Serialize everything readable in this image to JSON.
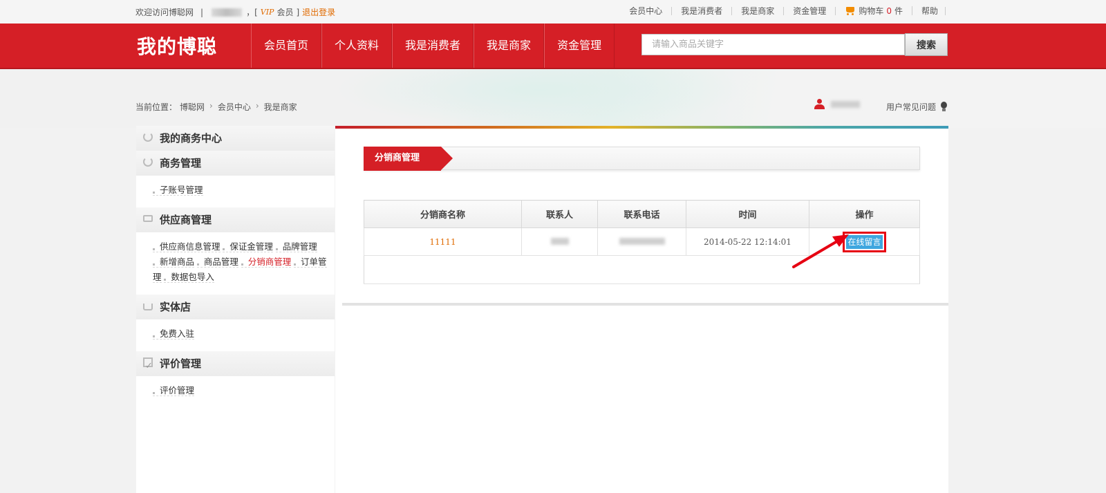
{
  "topbar": {
    "welcome": "欢迎访问博聪网",
    "bracket_open": "，[",
    "vip": "VIP",
    "member": "会员",
    "bracket_close": "]",
    "logout": "退出登录",
    "links": [
      "会员中心",
      "我是消费者",
      "我是商家",
      "资金管理"
    ],
    "cart_label": "购物车",
    "cart_count": "0",
    "cart_unit": "件",
    "help": "帮助"
  },
  "header": {
    "logo": "我的博聪",
    "nav": [
      "会员首页",
      "个人资料",
      "我是消费者",
      "我是商家",
      "资金管理"
    ],
    "search_placeholder": "请输入商品关键字",
    "search_button": "搜索"
  },
  "breadcrumb": {
    "prefix": "当前位置：",
    "items": [
      "博聪网",
      "会员中心",
      "我是商家"
    ]
  },
  "user": {
    "faq": "用户常见问题"
  },
  "sidebar": {
    "title": "我的商务中心",
    "groups": [
      {
        "title": "商务管理",
        "icon": "refresh-icon",
        "items": [
          "子账号管理"
        ]
      },
      {
        "title": "供应商管理",
        "icon": "card-icon",
        "items": [
          "供应商信息管理",
          "保证金管理",
          "品牌管理",
          "新增商品",
          "商品管理",
          "分销商管理",
          "订单管理",
          "数据包导入"
        ]
      },
      {
        "title": "实体店",
        "icon": "tray-icon",
        "items": [
          "免费入驻"
        ]
      },
      {
        "title": "评价管理",
        "icon": "checkbox-icon",
        "items": [
          "评价管理"
        ]
      }
    ],
    "active_item": "分销商管理"
  },
  "main": {
    "section_title": "分销商管理",
    "table": {
      "headers": [
        "分销商名称",
        "联系人",
        "联系电话",
        "时间",
        "操作"
      ],
      "rows": [
        {
          "name": "11111",
          "time": "2014-05-22 12:14:01",
          "action": "在线留言"
        }
      ]
    }
  },
  "colors": {
    "brand_red": "#d51f26",
    "accent_orange": "#e06a00",
    "action_blue": "#3ea6df",
    "highlight_red": "#e60012"
  }
}
